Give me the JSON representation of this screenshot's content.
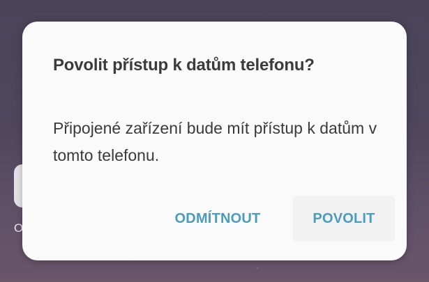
{
  "background": {
    "label_fragment": "O"
  },
  "dialog": {
    "title": "Povolit přístup k datům telefonu?",
    "message": "Připojené zařízení bude mít přístup k datům v tomto telefonu.",
    "buttons": {
      "deny": "ODMÍTNOUT",
      "allow": "POVOLIT"
    }
  },
  "colors": {
    "accent": "#4a9cbd",
    "dialog_background": "#fafafa",
    "text": "#3a3a3a"
  }
}
